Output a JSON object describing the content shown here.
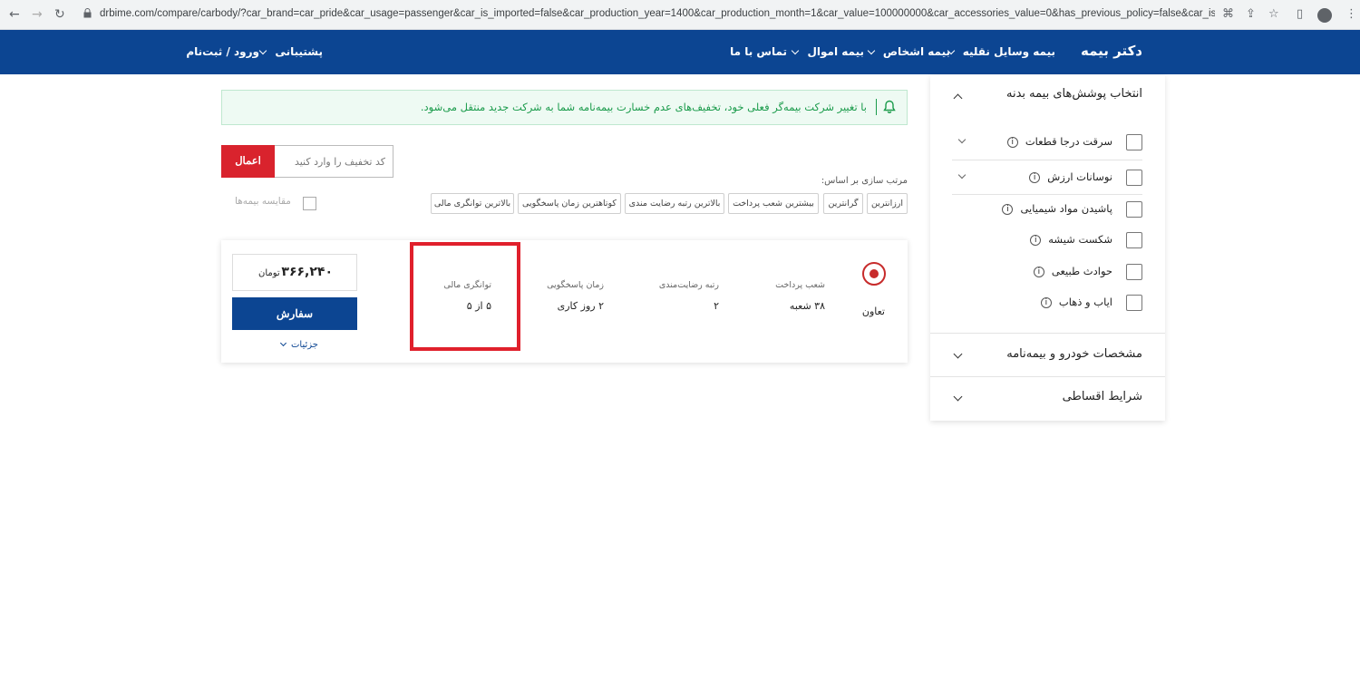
{
  "browser": {
    "url": "drbime.com/compare/carbody/?car_brand=car_pride&car_usage=passenger&car_is_imported=false&car_production_year=1400&car_production_month=1&car_value=100000000&car_accessories_value=0&has_previous_policy=false&car_is_new=true&..."
  },
  "nav": {
    "logo": "دکتر بیمه",
    "items": [
      "بیمه وسایل نقلیه",
      "بیمه اشخاص",
      "بیمه اموال",
      "تماس با ما"
    ],
    "support": "پشتیبانی",
    "login": "ورود / ثبت‌نام"
  },
  "sidebar": {
    "coverages_title": "انتخاب پوشش‌های بیمه بدنه",
    "coverages": [
      "سرقت درجا قطعات",
      "نوسانات ارزش",
      "پاشیدن مواد شیمیایی",
      "شکست شیشه",
      "حوادث طبیعی",
      "ایاب و ذهاب"
    ],
    "car_specs": "مشخصات خودرو و بیمه‌نامه",
    "installments": "شرایط اقساطی"
  },
  "alert": {
    "text": "با تغییر شرکت بیمه‌گر فعلی خود، تخفیف‌های عدم خسارت بیمه‌نامه شما به شرکت جدید منتقل می‌شود."
  },
  "discount": {
    "placeholder": "کد تخفیف را وارد کنید",
    "apply": "اعمال"
  },
  "sort": {
    "label": "مرتب سازی بر اساس:",
    "options": [
      "ارزانترین",
      "گرانترین",
      "بیشترین شعب پرداخت",
      "بالاترین رتبه رضایت مندی",
      "کوتاهترین زمان پاسخگویی",
      "بالاترین توانگری مالی"
    ]
  },
  "compare": "مقایسه بیمه‌ها",
  "result": {
    "company": "تعاون",
    "columns": [
      {
        "title": "شعب پرداخت",
        "value": "۳۸ شعبه"
      },
      {
        "title": "رتبه رضایت‌مندی",
        "value": "۲"
      },
      {
        "title": "زمان پاسخگویی",
        "value": "۲ روز کاری"
      },
      {
        "title": "توانگری مالی",
        "value": "۵ از ۵"
      }
    ],
    "price": "۳۶۶,۲۴۰",
    "unit": "تومان",
    "order": "سفارش",
    "details": "جزئیات"
  }
}
